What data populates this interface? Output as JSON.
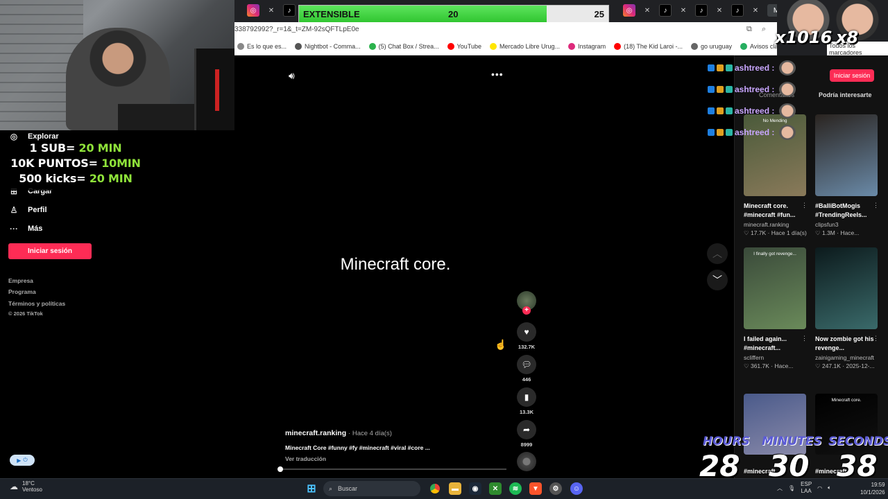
{
  "goal": {
    "label": "EXTENSIBLE",
    "current": "20",
    "max": "25",
    "progress_fraction": 0.8
  },
  "browser": {
    "url_fragment": "338792992?_r=1&_t=ZM-92sQFTLpE0e",
    "bookmarks": [
      {
        "label": "Es lo que es...",
        "color": "#888888"
      },
      {
        "label": "Nightbot - Comma...",
        "color": "#555555"
      },
      {
        "label": "(5) Chat Box / Strea...",
        "color": "#2bb24c"
      },
      {
        "label": "YouTube",
        "color": "#ff0000"
      },
      {
        "label": "Mercado Libre Urug...",
        "color": "#ffe600"
      },
      {
        "label": "Instagram",
        "color": "#dd2a7b"
      },
      {
        "label": "(18) The Kid Laroi -...",
        "color": "#ff0000"
      },
      {
        "label": "go uruguay",
        "color": "#666666"
      },
      {
        "label": "Avisos clasificados g...",
        "color": "#27ae60"
      }
    ],
    "all_bookmarks": "Todos los marcadores"
  },
  "emotes": {
    "mult1": "x1016",
    "mult2": "x8"
  },
  "rules": [
    {
      "prefix": "1 SUB= ",
      "value": "20 MIN"
    },
    {
      "prefix": "10K PUNTOS= ",
      "value": "10MIN"
    },
    {
      "prefix": "500 kicks= ",
      "value": "20 MIN"
    }
  ],
  "sidebar": {
    "explore": "Explorar",
    "upload": "Cargar",
    "profile": "Perfil",
    "more": "Más",
    "login": "Iniciar sesión",
    "footer": [
      "Empresa",
      "Programa",
      "Términos y políticas",
      "© 2026 TikTok"
    ]
  },
  "video": {
    "caption_big": "Minecraft core.",
    "author": "minecraft.ranking",
    "time": "Hace 4 día(s)",
    "description": "Minecraft Core #funny #fy #minecraft #viral #core ...",
    "translate": "Ver traducción",
    "likes": "132.7K",
    "comments": "446",
    "saves": "13.3K",
    "shares": "8999",
    "progress_fraction": 0.0
  },
  "right_panel": {
    "login": "Iniciar sesión",
    "tab_comments": "Comentarios",
    "tab_interest": "Podría interesarte",
    "cards": [
      {
        "title": "Minecraft core. #minecraft #fun...",
        "author": "minecraft.ranking",
        "meta": "♡ 17.7K · Hace 1 día(s)",
        "thumb_text": "No Mending",
        "c1": "#4a5a3a",
        "c2": "#8a7a5a"
      },
      {
        "title": "#BalliBotMogis #TrendingReels...",
        "author": "clipsfun3",
        "meta": "♡ 1.3M · Hace...",
        "thumb_text": "",
        "c1": "#2a2420",
        "c2": "#6a8aa8"
      },
      {
        "title": "I failed again... #minecraft...",
        "author": "scliffern",
        "meta": "♡ 361.7K · Hace...",
        "thumb_text": "I finally got revenge...",
        "c1": "#3a4a3a",
        "c2": "#6a8a5a"
      },
      {
        "title": "Now zombie got his revenge...",
        "author": "zainigaming_minecraft",
        "meta": "♡ 247.1K · 2025-12-...",
        "thumb_text": "",
        "c1": "#0c1a1c",
        "c2": "#3a6a6a"
      },
      {
        "title": "#minecraft",
        "author": "",
        "meta": "",
        "thumb_text": "",
        "c1": "#4a5a8a",
        "c2": "#8a8aaa"
      },
      {
        "title": "#minecraft",
        "author": "",
        "meta": "",
        "thumb_text": "Minecraft core.",
        "c1": "#000000",
        "c2": "#111111"
      }
    ]
  },
  "chat": {
    "username": "ashtreed :"
  },
  "timer": {
    "hours_label": "HOURS",
    "minutes_label": "MINUTES",
    "seconds_label": "SECONDS",
    "hours": "28",
    "minutes": "30",
    "seconds": "38"
  },
  "taskbar": {
    "weather_temp": "18°C",
    "weather_desc": "Ventoso",
    "search": "Buscar",
    "lang": "ESP",
    "lang2": "LAA",
    "time": "19:59",
    "date": "10/1/2026"
  },
  "colors": {
    "accent": "#fe2c55",
    "goal_fill": "#3fd43f",
    "rules_green": "#8fe33a",
    "timer_label": "#5b5bd6"
  }
}
